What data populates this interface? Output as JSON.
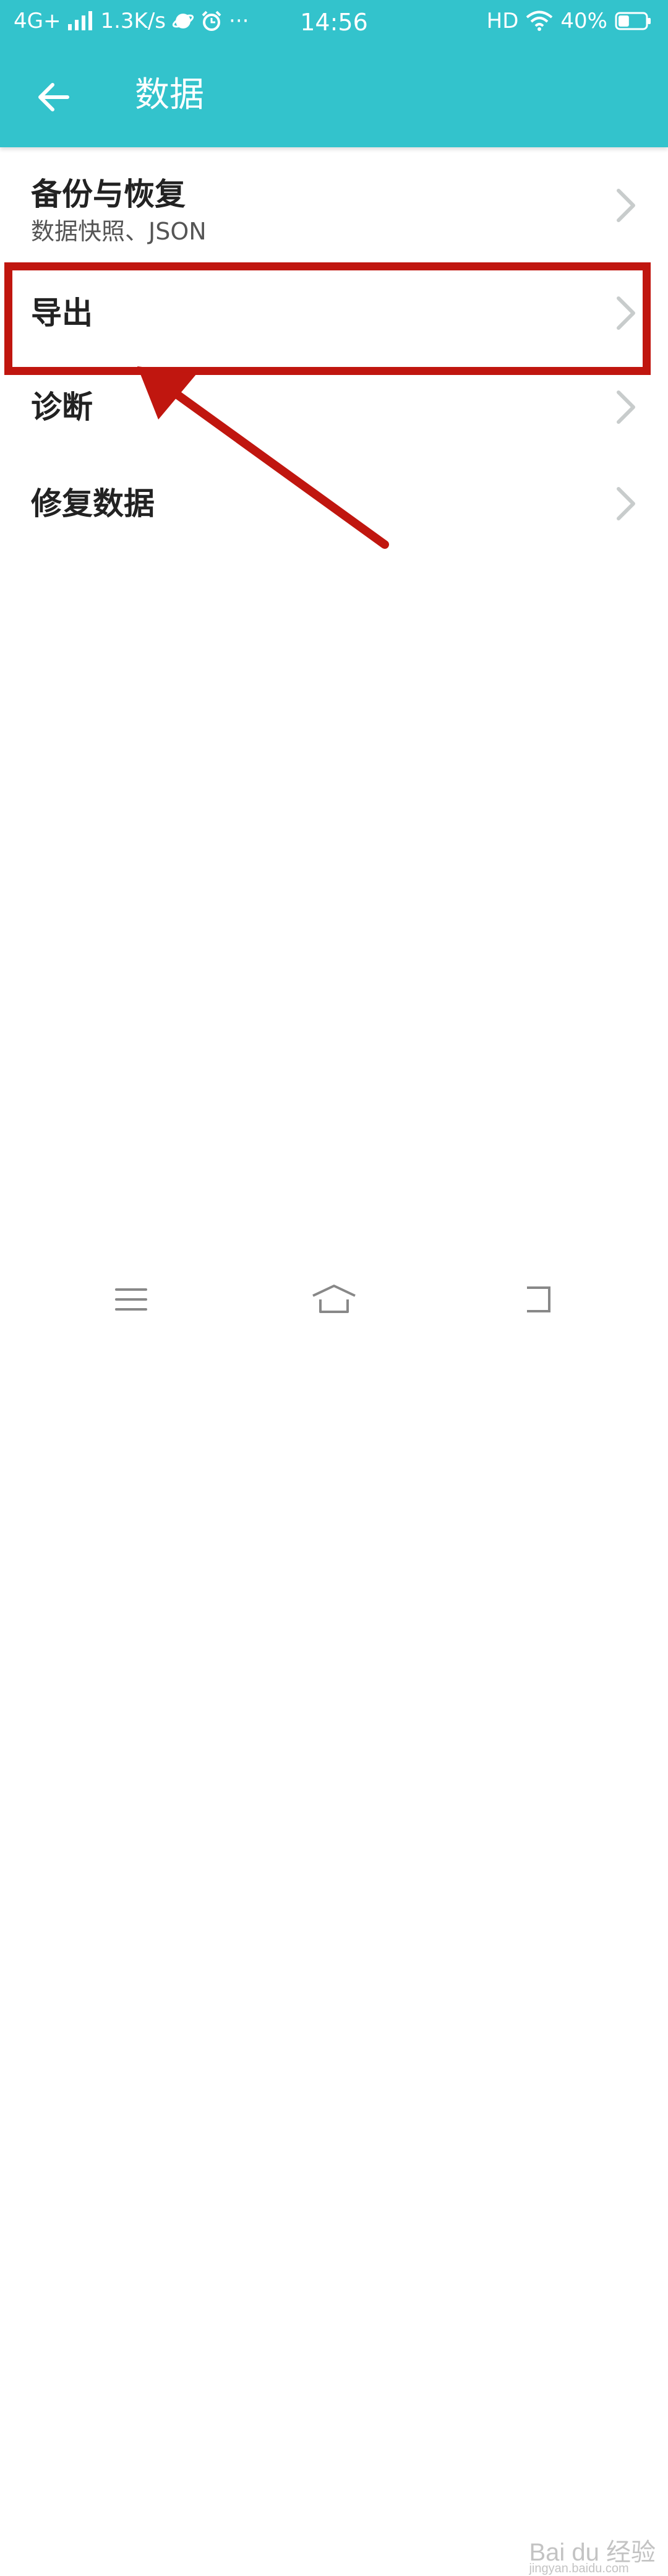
{
  "status_bar": {
    "network": "4G+",
    "speed": "1.3K/s",
    "more": "···",
    "time": "14:56",
    "hd": "HD",
    "battery": "40%",
    "battery_level": 0.4
  },
  "header": {
    "title": "数据"
  },
  "list": {
    "items": [
      {
        "title": "备份与恢复",
        "subtitle": "数据快照、JSON"
      },
      {
        "title": "导出"
      },
      {
        "title": "诊断"
      },
      {
        "title": "修复数据"
      }
    ]
  },
  "colors": {
    "header": "#33c3cc",
    "annotation_red": "#c0160f",
    "chevron": "#c8cccc"
  },
  "watermark": {
    "main": "Bai du 经验",
    "sub": "jingyan.baidu.com"
  }
}
